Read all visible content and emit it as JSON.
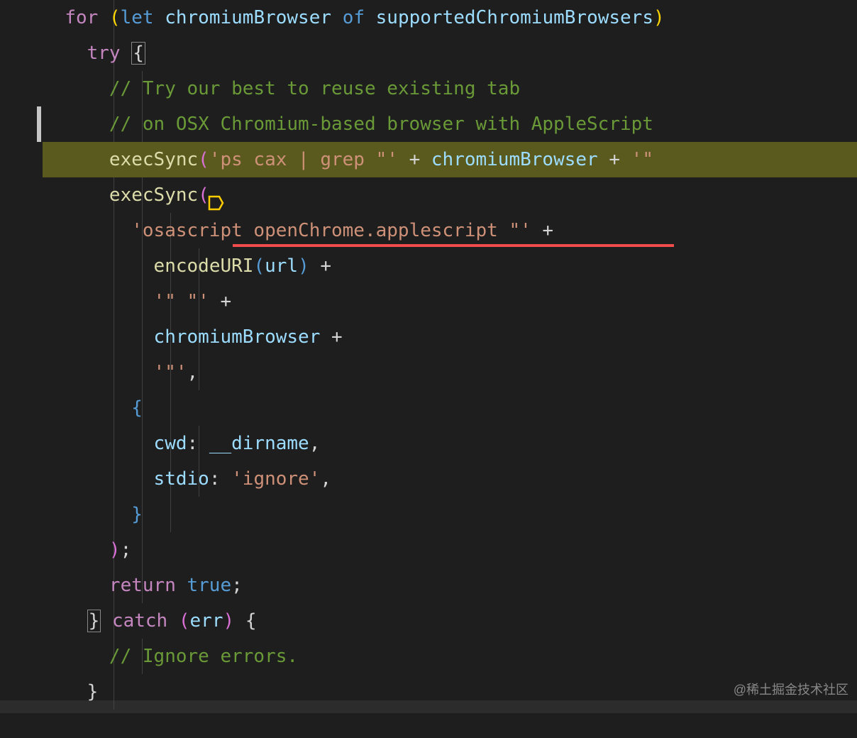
{
  "code": {
    "line1": {
      "for": "for",
      "paren_open": "(",
      "let": "let",
      "var1": "chromiumBrowser",
      "of": "of",
      "var2": "supportedChromiumBrowsers",
      "paren_close": ")"
    },
    "line2": {
      "try": "try",
      "brace": "{"
    },
    "line3": {
      "comment": "// Try our best to reuse existing tab"
    },
    "line4": {
      "comment": "// on OSX Chromium-based browser with AppleScript"
    },
    "line5": {
      "func": "execSync",
      "paren_open": "(",
      "string1": "'ps cax | grep \"'",
      "plus1": "+",
      "var": "chromiumBrowser",
      "plus2": "+",
      "string2": "'\""
    },
    "line6": {
      "func": "execSync",
      "paren_open": "("
    },
    "line7": {
      "string": "'osascript openChrome.applescript \"'",
      "plus": "+"
    },
    "line8": {
      "func": "encodeURI",
      "paren_open": "(",
      "var": "url",
      "paren_close": ")",
      "plus": "+"
    },
    "line9": {
      "string": "'\" \"'",
      "plus": "+"
    },
    "line10": {
      "var": "chromiumBrowser",
      "plus": "+"
    },
    "line11": {
      "string": "'\"'",
      "comma": ","
    },
    "line12": {
      "brace": "{"
    },
    "line13": {
      "key": "cwd",
      "colon": ":",
      "val": "__dirname",
      "comma": ","
    },
    "line14": {
      "key": "stdio",
      "colon": ":",
      "val": "'ignore'",
      "comma": ","
    },
    "line15": {
      "brace": "}"
    },
    "line16": {
      "paren_close": ")",
      "semi": ";"
    },
    "line17": {
      "return": "return",
      "true": "true",
      "semi": ";"
    },
    "line18": {
      "brace_close": "}",
      "catch": "catch",
      "paren_open": "(",
      "err": "err",
      "paren_close": ")",
      "brace_open": "{"
    },
    "line19": {
      "comment": "// Ignore errors."
    },
    "line20": {
      "brace": "}"
    }
  },
  "watermark": "@稀土掘金技术社区"
}
